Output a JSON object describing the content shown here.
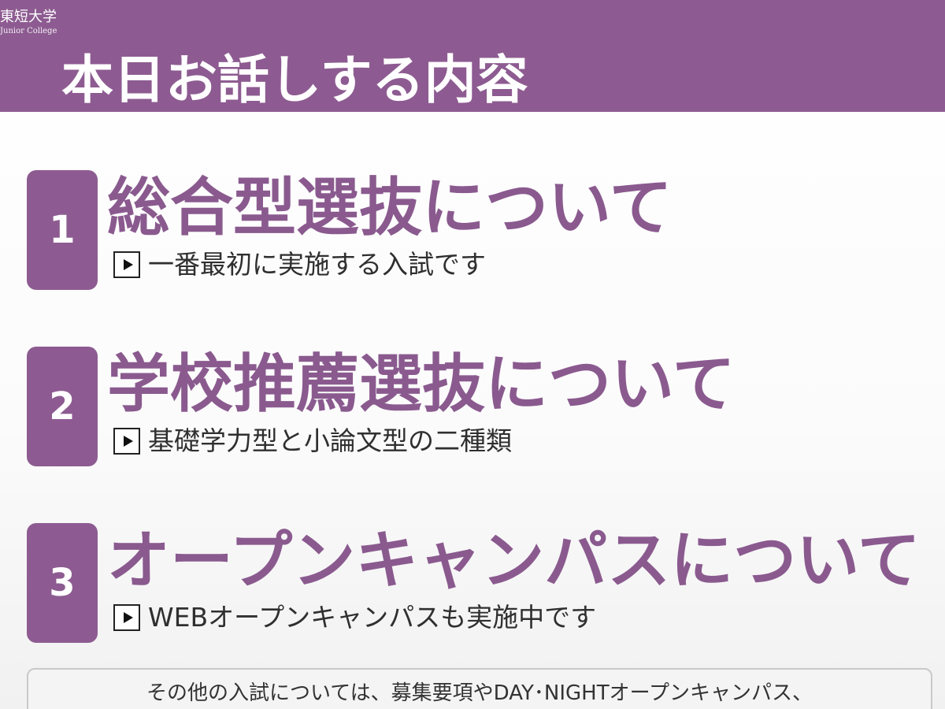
{
  "header": {
    "logo_text": "東短大学",
    "logo_subtext": "Junior College",
    "title": "本日お話しする内容"
  },
  "items": [
    {
      "number": "1",
      "heading": "総合型選抜について",
      "subtext": "一番最初に実施する入試です",
      "icon": "play-icon"
    },
    {
      "number": "2",
      "heading": "学校推薦選抜について",
      "subtext": "基礎学力型と小論文型の二種類",
      "icon": "play-icon"
    },
    {
      "number": "3",
      "heading": "オープンキャンパスについて",
      "subtext": "WEBオープンキャンパスも実施中です",
      "icon": "play-icon"
    }
  ],
  "notice": {
    "text": "その他の入試については、募集要項やDAY･NIGHTオープンキャンパス、"
  },
  "colors": {
    "header_bg": "#8d5b91",
    "accent_text": "#8a5a8f",
    "number_box": "#8d5b91"
  }
}
